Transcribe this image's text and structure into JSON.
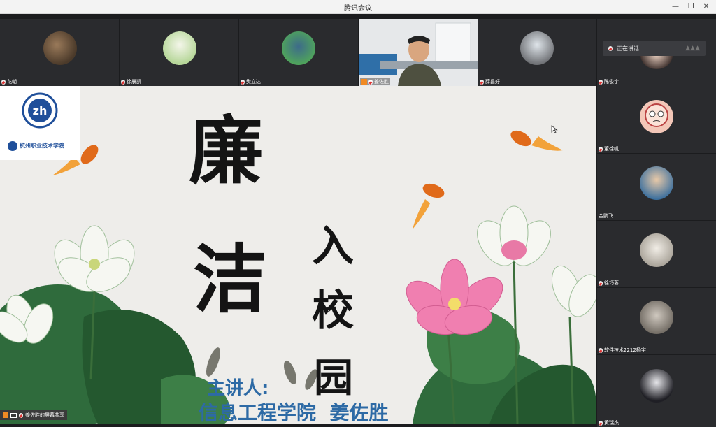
{
  "window": {
    "title": "腾讯会议"
  },
  "top_participants": [
    {
      "name": "花朝",
      "muted": true
    },
    {
      "name": "徐晨凯",
      "muted": true
    },
    {
      "name": "樊立达",
      "muted": true
    },
    {
      "name": "姜佐胜",
      "muted": false
    },
    {
      "name": "薛昌好",
      "muted": true
    },
    {
      "name": "陈俊宇",
      "muted": true
    }
  ],
  "speaking": {
    "label": "正在讲话:"
  },
  "side_participants": [
    {
      "name": "董徐帆",
      "muted": true
    },
    {
      "name": "金鹏飞",
      "muted": false
    },
    {
      "name": "徐巧蓉",
      "muted": true
    },
    {
      "name": "软件技术2212杨宇",
      "muted": true
    },
    {
      "name": "黄瑞杰",
      "muted": true
    }
  ],
  "slide": {
    "school_name": "杭州职业技术学院",
    "title_chars": [
      "廉",
      "洁",
      "入",
      "校",
      "园"
    ],
    "speaker_label": "主讲人:",
    "speaker_line": "信息工程学院  姜佐胜"
  },
  "share_bar": {
    "label": "姜佐胜的屏幕共享"
  },
  "colors": {
    "accent_blue": "#2d6aa5",
    "lotus_pink": "#e879a6",
    "leaf_green": "#2f6b3c",
    "fish_orange": "#e06a1a"
  }
}
